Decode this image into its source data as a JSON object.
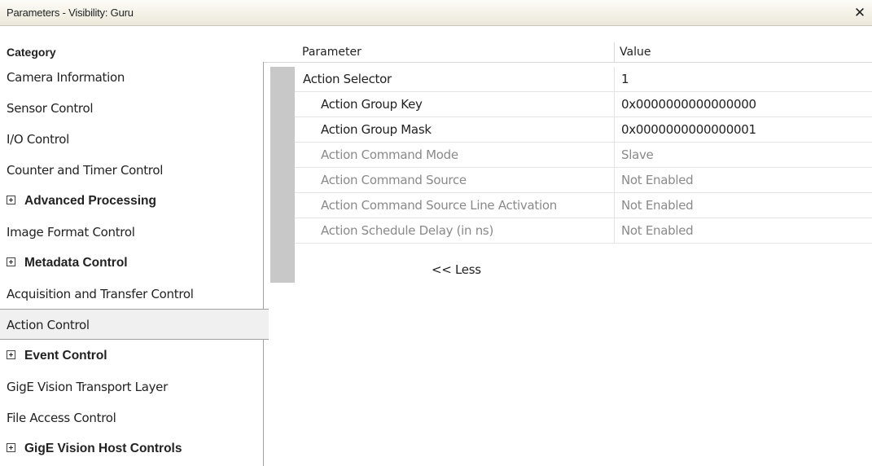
{
  "window": {
    "title": "Parameters - Visibility: Guru",
    "close_glyph": "✕",
    "close_icon": "close-icon"
  },
  "columns": {
    "category": "Category",
    "parameter": "Parameter",
    "value": "Value"
  },
  "categories": [
    {
      "label": "Camera Information",
      "expandable": false,
      "selected": false
    },
    {
      "label": "Sensor Control",
      "expandable": false,
      "selected": false
    },
    {
      "label": "I/O Control",
      "expandable": false,
      "selected": false
    },
    {
      "label": "Counter and Timer Control",
      "expandable": false,
      "selected": false
    },
    {
      "label": "Advanced Processing",
      "expandable": true,
      "selected": false
    },
    {
      "label": "Image Format Control",
      "expandable": false,
      "selected": false
    },
    {
      "label": "Metadata Control",
      "expandable": true,
      "selected": false
    },
    {
      "label": "Acquisition and Transfer Control",
      "expandable": false,
      "selected": false
    },
    {
      "label": "Action Control",
      "expandable": false,
      "selected": true
    },
    {
      "label": "Event Control",
      "expandable": true,
      "selected": false
    },
    {
      "label": "GigE Vision Transport Layer",
      "expandable": false,
      "selected": false
    },
    {
      "label": "File Access Control",
      "expandable": false,
      "selected": false
    },
    {
      "label": "GigE Vision Host Controls",
      "expandable": true,
      "selected": false
    }
  ],
  "parameters": [
    {
      "name": "Action Selector",
      "value": "1",
      "enabled": true,
      "child": false
    },
    {
      "name": "Action Group Key",
      "value": "0x0000000000000000",
      "enabled": true,
      "child": true
    },
    {
      "name": "Action Group Mask",
      "value": "0x0000000000000001",
      "enabled": true,
      "child": true
    },
    {
      "name": "Action Command Mode",
      "value": "Slave",
      "enabled": false,
      "child": true
    },
    {
      "name": "Action Command Source",
      "value": "Not Enabled",
      "enabled": false,
      "child": true
    },
    {
      "name": "Action Command Source Line Activation",
      "value": "Not Enabled",
      "enabled": false,
      "child": true
    },
    {
      "name": "Action Schedule Delay (in ns)",
      "value": "Not Enabled",
      "enabled": false,
      "child": true
    }
  ],
  "less_link": "<< Less",
  "colors": {
    "disabled_text": "#8a8a8a",
    "selected_bg": "#f0f0f0",
    "gutter": "#c8c8c8"
  }
}
